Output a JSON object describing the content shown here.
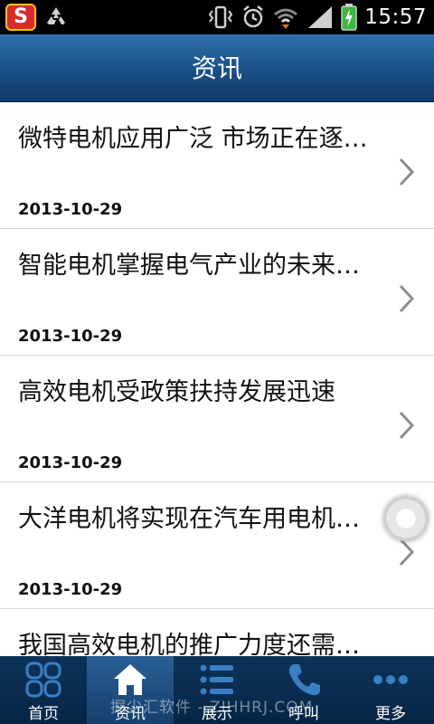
{
  "status_bar": {
    "time": "15:57",
    "icons": [
      "app-s-icon",
      "recycle-icon",
      "vibrate-icon",
      "alarm-icon",
      "wifi-icon",
      "signal-icon",
      "battery-charging-icon"
    ],
    "app_badge": "S"
  },
  "header": {
    "title": "资讯"
  },
  "news": [
    {
      "title": "微特电机应用广泛 市场正在逐…",
      "date": "2013-10-29"
    },
    {
      "title": "智能电机掌握电气产业的未来…",
      "date": "2013-10-29"
    },
    {
      "title": "高效电机受政策扶持发展迅速",
      "date": "2013-10-29"
    },
    {
      "title": "大洋电机将实现在汽车用电机…",
      "date": "2013-10-29"
    },
    {
      "title": "我国高效电机的推广力度还需…",
      "date": ""
    }
  ],
  "bottom_nav": [
    {
      "label": "首页",
      "icon": "grid-icon"
    },
    {
      "label": "资讯",
      "icon": "home-icon",
      "active": true
    },
    {
      "label": "展示",
      "icon": "list-icon"
    },
    {
      "label": "呼叫",
      "icon": "phone-icon"
    },
    {
      "label": "更多",
      "icon": "more-dots-icon"
    }
  ],
  "watermark": "掘尘汇软件 - ZIHHRJ.COM",
  "colors": {
    "header_blue": "#1a4f86",
    "nav_dark": "#062546",
    "nav_active": "#2a5f94",
    "icon_blue": "#3a7fc4"
  }
}
